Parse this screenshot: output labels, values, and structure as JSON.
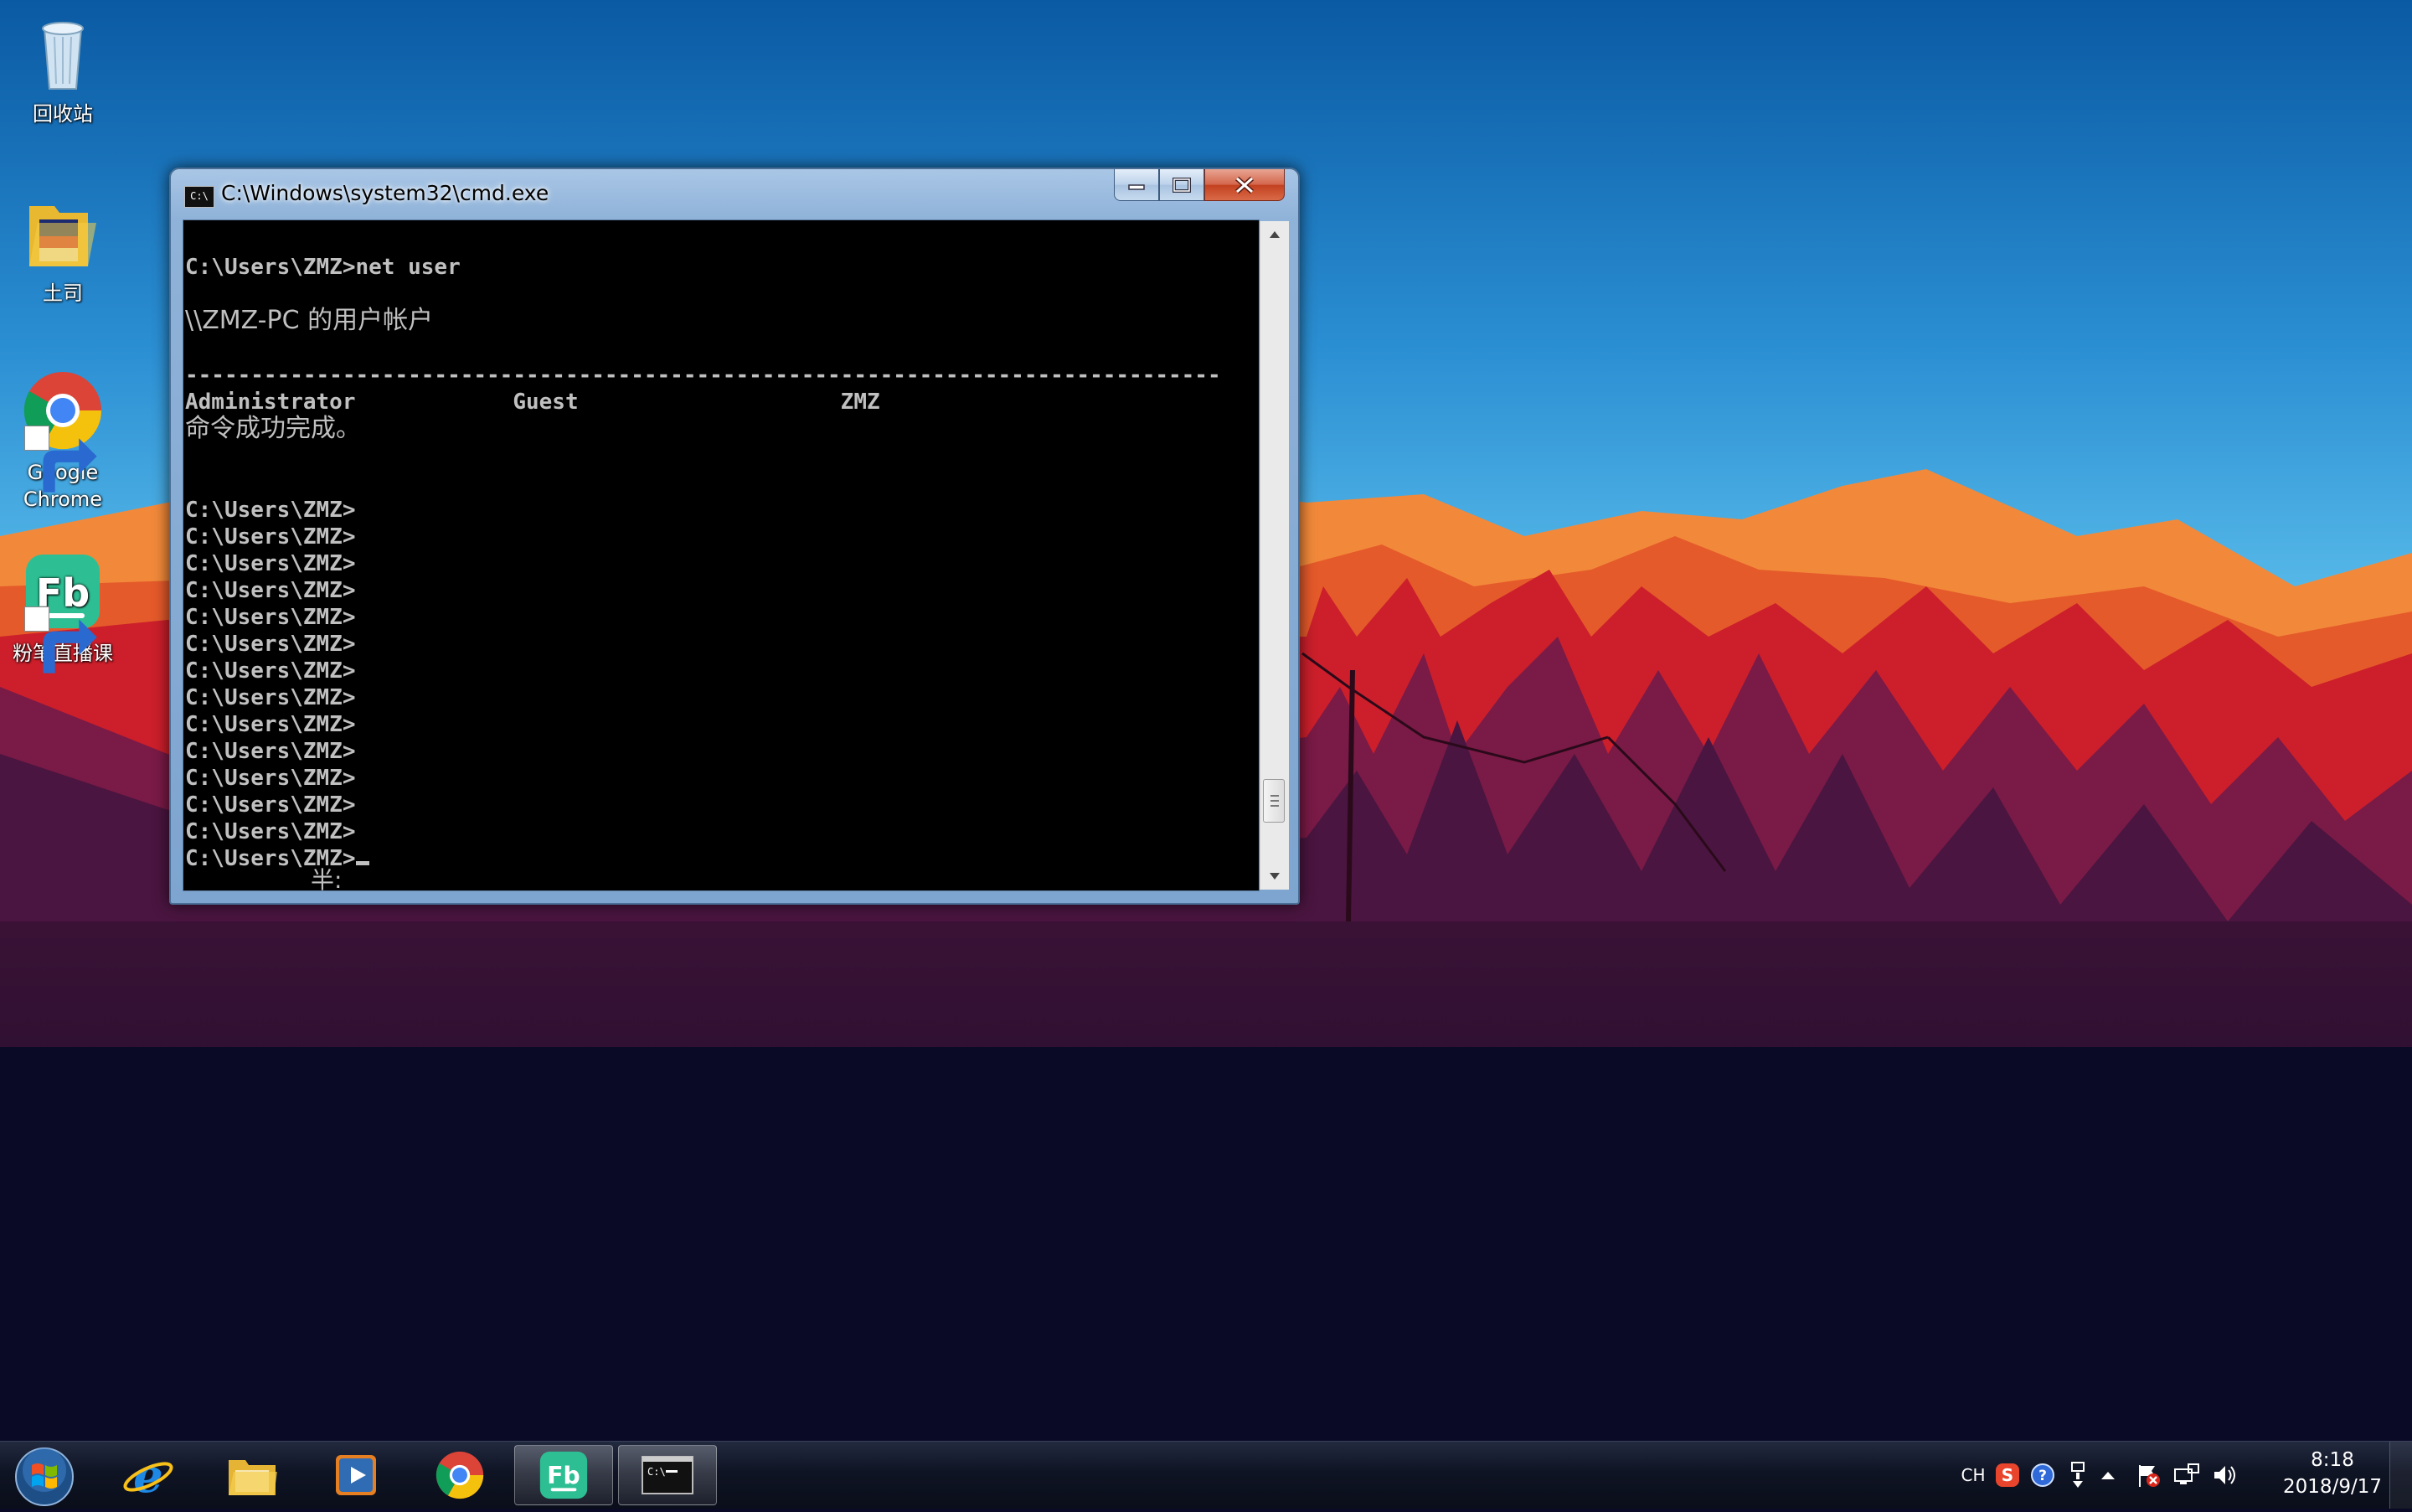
{
  "desktop": {
    "icons": [
      {
        "label": "回收站",
        "icon": "recycle-bin-icon"
      },
      {
        "label": "土司",
        "icon": "folder-icon"
      },
      {
        "label": "Google Chrome",
        "icon": "chrome-icon"
      },
      {
        "label": "粉笔直播课",
        "icon": "fenbi-icon"
      }
    ]
  },
  "cmd": {
    "title": "C:\\Windows\\system32\\cmd.exe",
    "lines": [
      "C:\\Users\\ZMZ>net user",
      "",
      "\\\\ZMZ-PC 的用户帐户",
      "",
      "-------------------------------------------------------------------------------",
      "Administrator            Guest                    ZMZ",
      "命令成功完成。",
      "",
      "",
      "C:\\Users\\ZMZ>",
      "C:\\Users\\ZMZ>",
      "C:\\Users\\ZMZ>",
      "C:\\Users\\ZMZ>",
      "C:\\Users\\ZMZ>",
      "C:\\Users\\ZMZ>",
      "C:\\Users\\ZMZ>",
      "C:\\Users\\ZMZ>",
      "C:\\Users\\ZMZ>",
      "C:\\Users\\ZMZ>",
      "C:\\Users\\ZMZ>",
      "C:\\Users\\ZMZ>",
      "C:\\Users\\ZMZ>",
      "C:\\Users\\ZMZ>"
    ],
    "ime_status": "半:",
    "scroll_position": 0.93
  },
  "taskbar": {
    "apps": [
      {
        "name": "internet-explorer",
        "icon": "ie-icon",
        "active": false
      },
      {
        "name": "file-explorer",
        "icon": "folder-icon",
        "active": false
      },
      {
        "name": "media-player",
        "icon": "media-player-icon",
        "active": false
      },
      {
        "name": "chrome",
        "icon": "chrome-icon",
        "active": false
      },
      {
        "name": "fenbi",
        "icon": "fenbi-icon",
        "active": true
      },
      {
        "name": "cmd",
        "icon": "cmd-icon",
        "active": true
      }
    ],
    "tray": {
      "language": "CH",
      "icons": [
        "sogou-icon",
        "help-icon",
        "usb-icon",
        "show-hidden-icon",
        "action-center-icon",
        "network-icon",
        "volume-icon"
      ],
      "time": "8:18",
      "date": "2018/9/17"
    }
  },
  "colors": {
    "console_bg": "#000000",
    "console_text": "#c0c0c0",
    "sky_top": "#0d5fa8",
    "sky_bottom": "#4bb1e4",
    "mountains_orange": "#f07a2a",
    "forest_red": "#c8202c",
    "night": "#0a0a26"
  }
}
